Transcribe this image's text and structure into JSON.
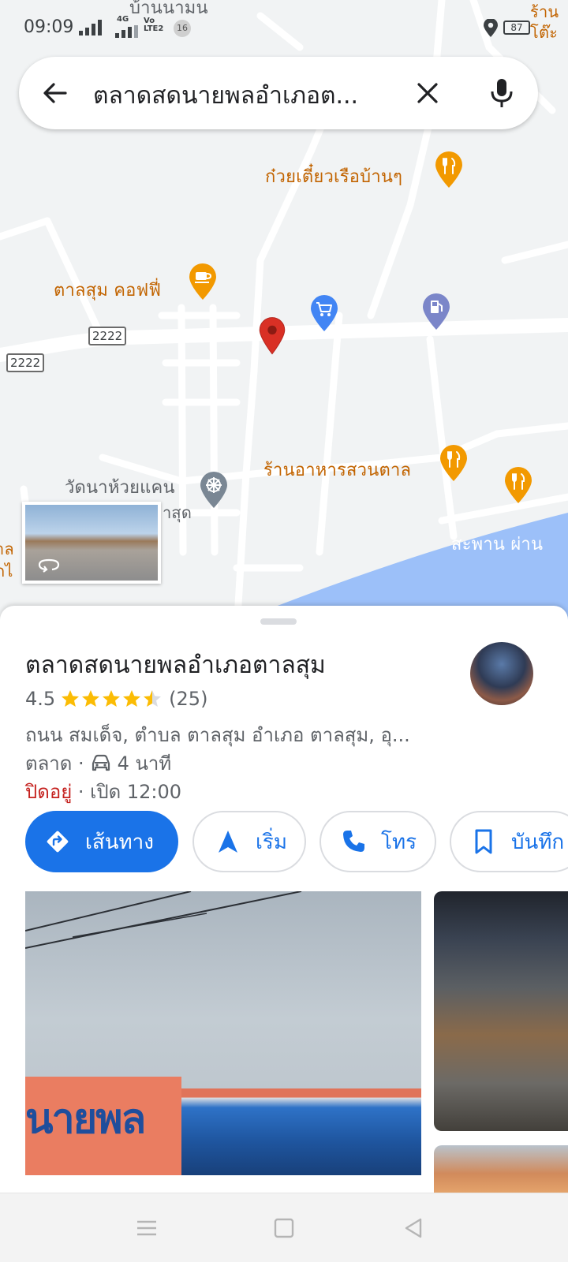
{
  "status_bar": {
    "time": "09:09",
    "network_type": "4G",
    "volte_label": "Vo LTE2",
    "notification_count": "16",
    "battery_level": "87"
  },
  "search": {
    "query": "ตลาดสดนายพลอำเภอต..."
  },
  "map": {
    "labels": {
      "village_top": "บ้านนามน",
      "edge_top_right": "ร้าน โต๊ะ",
      "restaurant_noodle": "ก๋วยเตี๋ยวเรือบ้านๆ",
      "cafe": "ตาลสุม คอฟฟี่",
      "route_shield_1": "2222",
      "route_shield_2": "2222",
      "restaurant_garden": "ร้านอาหารสวนตาล",
      "temple": "วัดนาห้วยแคน",
      "partial_label": "าสุด",
      "bridge": "สะพาน ผ่าน",
      "edge_left": "าล กไ"
    }
  },
  "place": {
    "name": "ตลาดสดนายพลอำเภอตาลสุม",
    "rating": "4.5",
    "rating_fraction": 0.9,
    "review_count": "(25)",
    "address": "ถนน สมเด็จ, ตำบล ตาลสุม อำเภอ ตาลสุม, อุ...",
    "category": "ตลาด ·",
    "drive_time": "4 นาที",
    "hours_status": "ปิดอยู่",
    "hours_detail": " · เปิด 12:00"
  },
  "actions": {
    "directions": "เส้นทาง",
    "start": "เริ่ม",
    "call": "โทร",
    "save": "บันทึก"
  },
  "photo": {
    "sign_text": "นายพล"
  },
  "colors": {
    "accent_blue": "#1a73e8",
    "pin_red": "#d93025",
    "poi_orange": "#f29900",
    "closed_red": "#c5221f",
    "water_blue": "#9cc0f9",
    "star_gold": "#fbbc04"
  }
}
